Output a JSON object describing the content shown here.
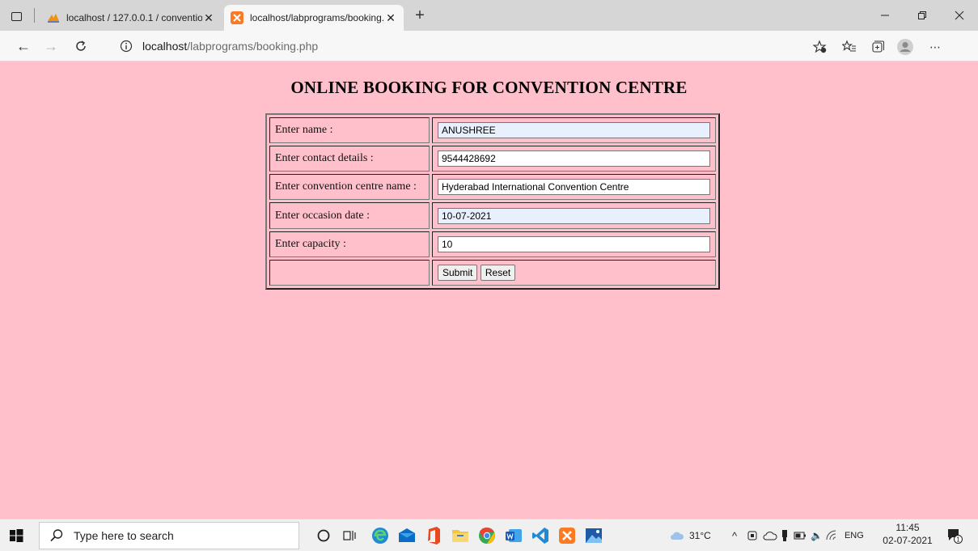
{
  "browser": {
    "tabs": [
      {
        "title": "localhost / 127.0.0.1 / conventio",
        "active": false
      },
      {
        "title": "localhost/labprograms/booking.p",
        "active": true
      }
    ],
    "url_host": "localhost",
    "url_path": "/labprograms/booking.php"
  },
  "page": {
    "heading": "ONLINE BOOKING FOR CONVENTION CENTRE",
    "form": {
      "fields": [
        {
          "label": "Enter name :",
          "value": "ANUSHREE"
        },
        {
          "label": "Enter contact details :",
          "value": "9544428692"
        },
        {
          "label": "Enter convention centre name :",
          "value": "Hyderabad International Convention Centre"
        },
        {
          "label": "Enter occasion date :",
          "value": "10-07-2021"
        },
        {
          "label": "Enter capacity :",
          "value": "10"
        }
      ],
      "submit_label": "Submit",
      "reset_label": "Reset"
    }
  },
  "taskbar": {
    "search_placeholder": "Type here to search",
    "weather": "31°C",
    "language": "ENG",
    "time": "11:45",
    "date": "02-07-2021",
    "notification_count": "1"
  },
  "colors": {
    "page_background": "#ffc0cb",
    "autofill_background": "#e8f0fe"
  }
}
